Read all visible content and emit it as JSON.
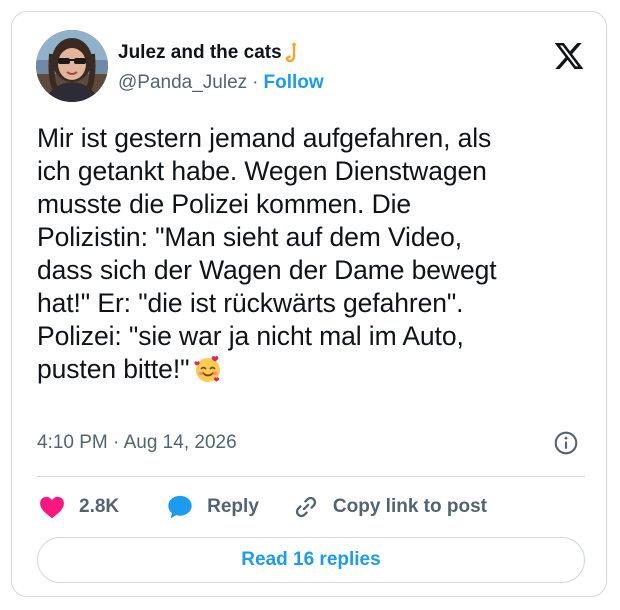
{
  "author": {
    "display_name": "Julez and the cats",
    "name_emoji": "hook-emoji",
    "handle": "@Panda_Julez",
    "separator": "·",
    "follow_label": "Follow"
  },
  "tweet": {
    "lines": [
      "Mir ist gestern jemand aufgefahren, als",
      "ich getankt habe. Wegen Dienstwagen",
      "musste die Polizei kommen. Die",
      "Polizistin: \"Man sieht auf dem Video,",
      "dass sich der Wagen der Dame bewegt",
      "hat!\" Er: \"die ist rückwärts gefahren\".",
      "Polizei: \"sie war ja nicht mal im Auto,",
      "pusten bitte!\""
    ],
    "trailing_emoji": "smiling-face-with-hearts-emoji"
  },
  "meta": {
    "timestamp": "4:10 PM · Aug 14, 2026",
    "info_icon": "info-icon"
  },
  "actions": {
    "likes_count": "2.8K",
    "reply_label": "Reply",
    "copy_link_label": "Copy link to post"
  },
  "read_replies_label": "Read 16 replies",
  "colors": {
    "accent": "#1d9bf0",
    "heart": "#f91880",
    "text": "#0f1419",
    "secondary": "#536471",
    "border": "#cfd9de"
  }
}
